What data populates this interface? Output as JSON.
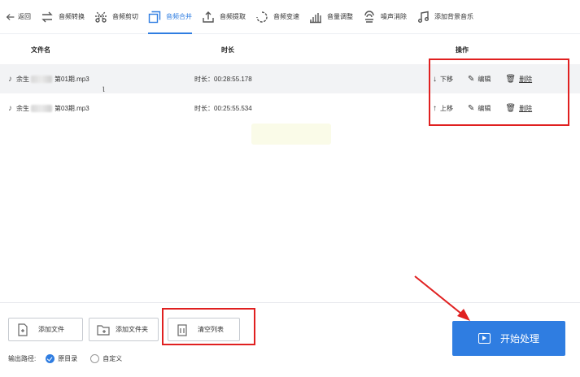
{
  "toolbar": {
    "items": [
      {
        "label": "返回",
        "icon": "arrow-left-icon"
      },
      {
        "label": "音频转换",
        "icon": "convert-icon"
      },
      {
        "label": "音频剪切",
        "icon": "scissors-icon"
      },
      {
        "label": "音频合并",
        "icon": "merge-icon",
        "active": true
      },
      {
        "label": "音频提取",
        "icon": "extract-icon"
      },
      {
        "label": "音频变速",
        "icon": "speed-icon"
      },
      {
        "label": "音量调整",
        "icon": "volume-bars-icon"
      },
      {
        "label": "噪声消除",
        "icon": "noise-icon"
      },
      {
        "label": "添加背景音乐",
        "icon": "music-note-icon"
      }
    ]
  },
  "table": {
    "headers": {
      "name": "文件名",
      "duration": "时长",
      "ops": "操作"
    },
    "rows": [
      {
        "name_prefix": "余生",
        "name_suffix": "第01期.mp3",
        "duration": "时长：00:28:55.178",
        "move_label": "下移",
        "move_icon": "arrow-down-icon",
        "edit_label": "编辑",
        "delete_label": "删除"
      },
      {
        "name_prefix": "余生",
        "name_suffix": "第03期.mp3",
        "duration": "时长：00:25:55.534",
        "move_label": "上移",
        "move_icon": "arrow-up-icon",
        "edit_label": "编辑",
        "delete_label": "删除"
      }
    ]
  },
  "bottom": {
    "add_file": "添加文件",
    "add_folder": "添加文件夹",
    "clear_list": "清空列表",
    "output_label": "输出路径:",
    "option_original": "原目录",
    "option_custom": "自定义",
    "start": "开始处理"
  },
  "colors": {
    "accent": "#2f7de1",
    "highlight": "#e02020"
  }
}
